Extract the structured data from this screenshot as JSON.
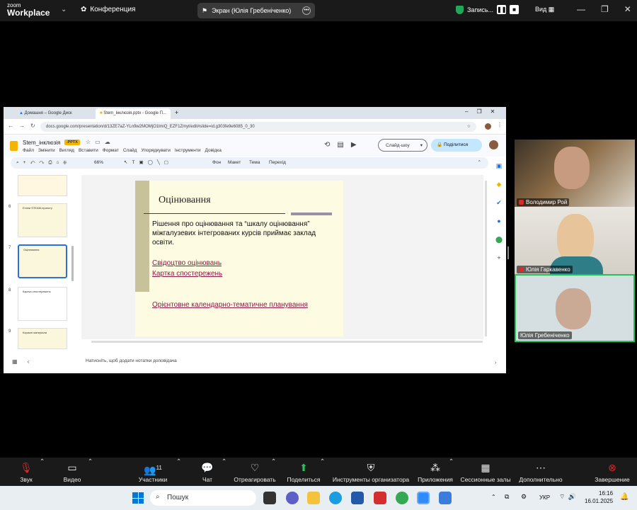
{
  "zoom_top": {
    "logo_top": "zoom",
    "logo_bottom": "Workplace",
    "conference_label": "Конференция",
    "screen_share_label": "Экран (Юлія Гребеніченко)",
    "record_label": "Запись...",
    "view_label": "Вид"
  },
  "browser": {
    "tabs": [
      {
        "label": "Домашня – Google Диск"
      },
      {
        "label": "Stem_інклюзія.pptx - Google П..."
      }
    ],
    "url": "docs.google.com/presentation/d/13ZE7aZ-YLn9w2MOMjO1lmiQ_EZF1Zmyt/edit#slide=id.g303fe9e6085_0_30",
    "doc_title": "Stem_інклюзія",
    "doc_badge": ".PPTX",
    "menus": [
      "Файл",
      "Змінити",
      "Вигляд",
      "Вставити",
      "Формат",
      "Слайд",
      "Упорядкувати",
      "Інструменти",
      "Довідка"
    ],
    "slideshow_label": "Слайд-шоу",
    "share_label": "Поділитися",
    "zoom_level": "66%",
    "toolbar_items": [
      "Фон",
      "Макет",
      "Тема",
      "Перехід"
    ],
    "thumb_numbers": [
      "6",
      "7",
      "8",
      "9"
    ],
    "thumb_titles": [
      "Етапи STEAM-проекту",
      "Оцінювання",
      "Картка спостережень",
      "Корисні матеріали"
    ],
    "notes_placeholder": "Натисніть, щоб додати нотатки доповідача"
  },
  "slide": {
    "title": "Оцінювання",
    "body": "Рішення про оцінювання та “шкалу оцінювання” міжгалузевих інтегрованих курсів приймає заклад освіти.",
    "links": [
      "Свідоцтво оцінювань",
      "Картка спостережень",
      "Орієнтовне календарно-тематичне планування"
    ]
  },
  "participants": [
    {
      "name": "Володимир Рой",
      "muted": true
    },
    {
      "name": "Юлія Гаркавенко",
      "muted": true
    },
    {
      "name": "Юлія Гребеніченко",
      "muted": false
    }
  ],
  "zoom_bottom": {
    "buttons": [
      "Звук",
      "Видео",
      "Участники",
      "Чат",
      "Отреагировать",
      "Поделиться",
      "Инструменты организатора",
      "Приложения",
      "Сессионные залы",
      "Дополнительно",
      "Завершение"
    ],
    "participants_count": "11"
  },
  "taskbar": {
    "search_placeholder": "Пошук",
    "lang": "УКР",
    "time": "16:16",
    "date": "16.01.2025"
  },
  "colors": {
    "zoom_bg": "#1a1a1a",
    "share_green": "#23a55a",
    "slide_bg": "#fdfbe2",
    "slide_link": "#8c1a45",
    "end_red": "#e02828"
  }
}
